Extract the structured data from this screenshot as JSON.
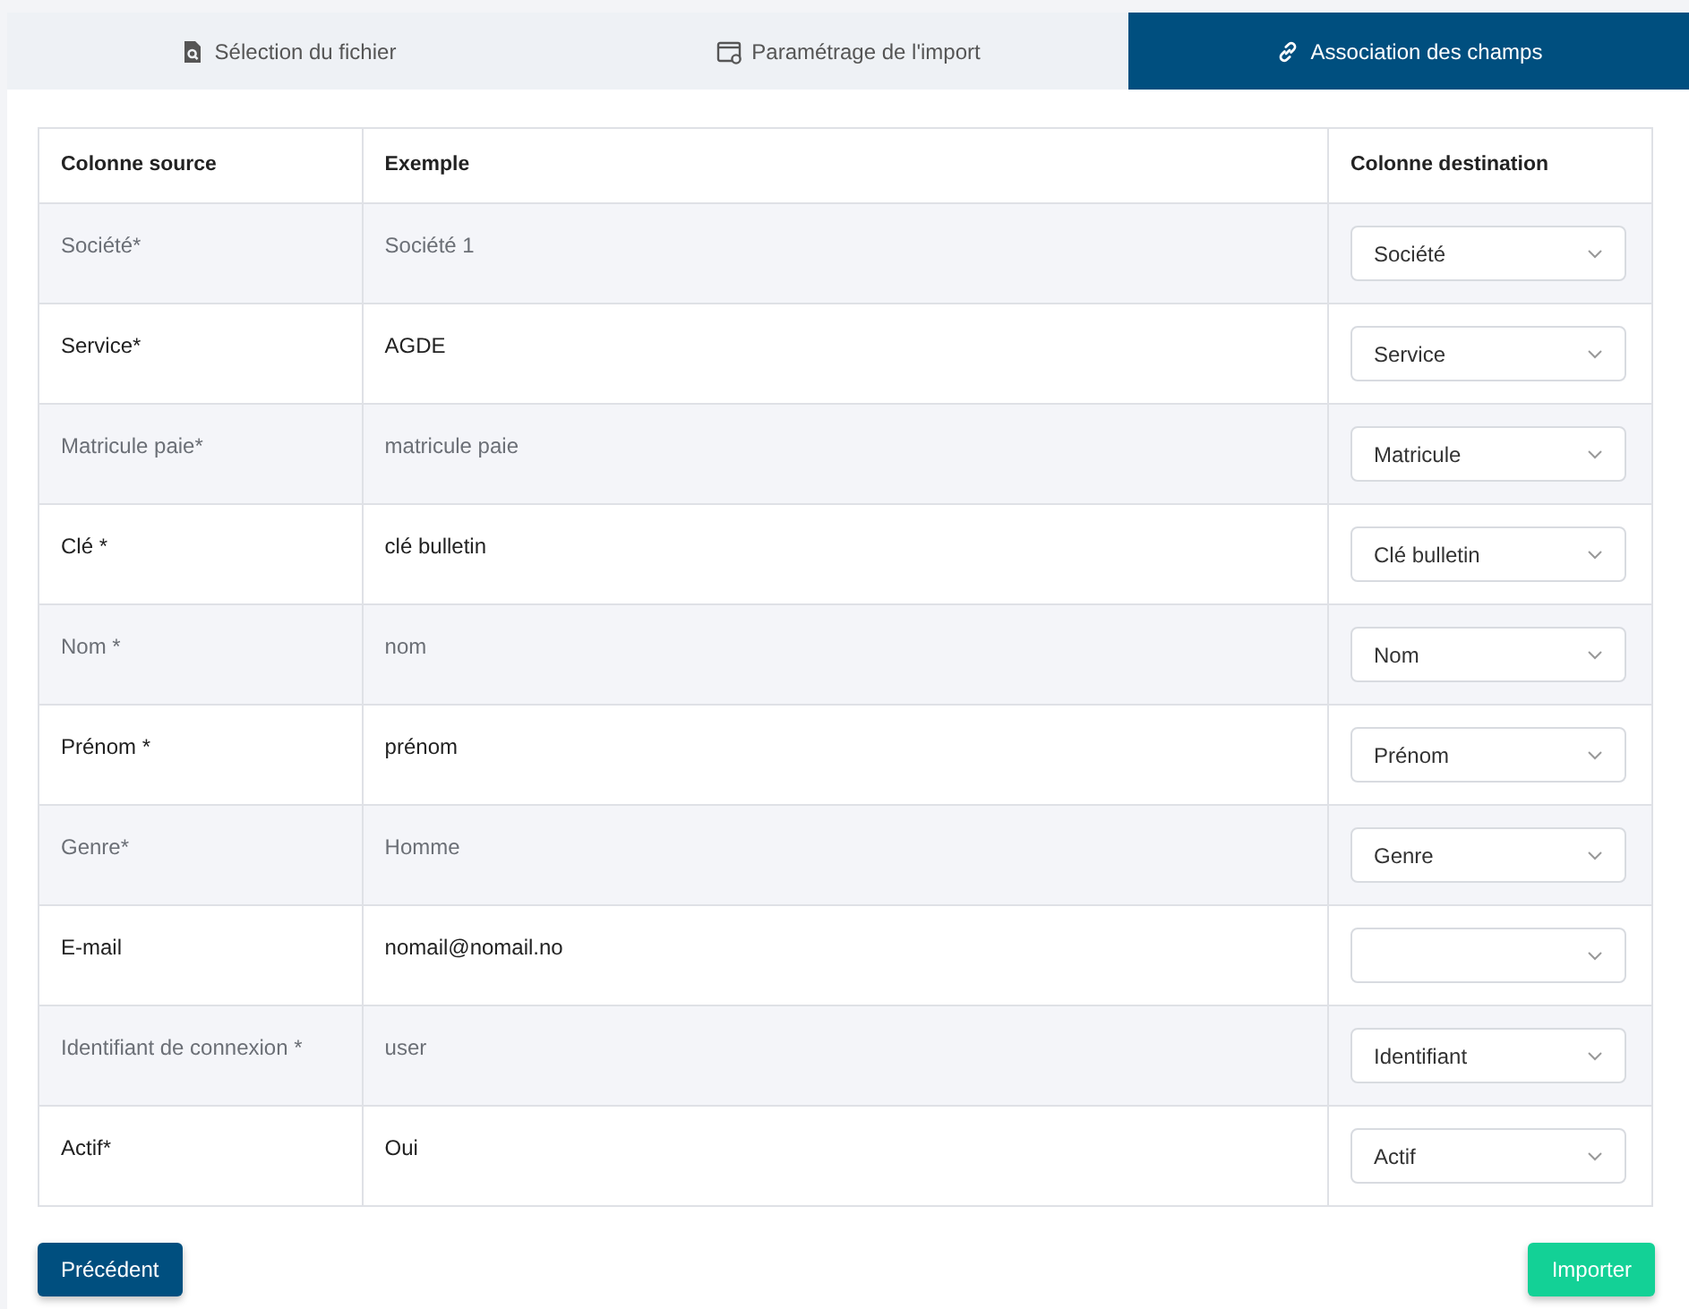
{
  "tabs": [
    {
      "label": "Sélection du fichier",
      "selected": false
    },
    {
      "label": "Paramétrage de l'import",
      "selected": false
    },
    {
      "label": "Association des champs",
      "selected": true
    }
  ],
  "table": {
    "columns": [
      "Colonne source",
      "Exemple",
      "Colonne destination"
    ],
    "rows": [
      {
        "source": "Société*",
        "example": "Société 1",
        "destination": "Société"
      },
      {
        "source": "Service*",
        "example": "AGDE",
        "destination": "Service"
      },
      {
        "source": "Matricule paie*",
        "example": "matricule paie",
        "destination": "Matricule"
      },
      {
        "source": "Clé *",
        "example": "clé bulletin",
        "destination": "Clé bulletin"
      },
      {
        "source": "Nom *",
        "example": "nom",
        "destination": "Nom"
      },
      {
        "source": "Prénom *",
        "example": "prénom",
        "destination": "Prénom"
      },
      {
        "source": "Genre*",
        "example": "Homme",
        "destination": "Genre"
      },
      {
        "source": "E-mail",
        "example": "nomail@nomail.no"
      },
      {
        "source": "Identifiant de connexion *",
        "example": "user",
        "destination": "Identifiant"
      },
      {
        "source": "Actif*",
        "example": "Oui",
        "destination": "Actif"
      }
    ]
  },
  "buttons": [
    {
      "label": "Précédent",
      "kind": "primary"
    },
    {
      "label": "Importer",
      "kind": "success"
    }
  ]
}
